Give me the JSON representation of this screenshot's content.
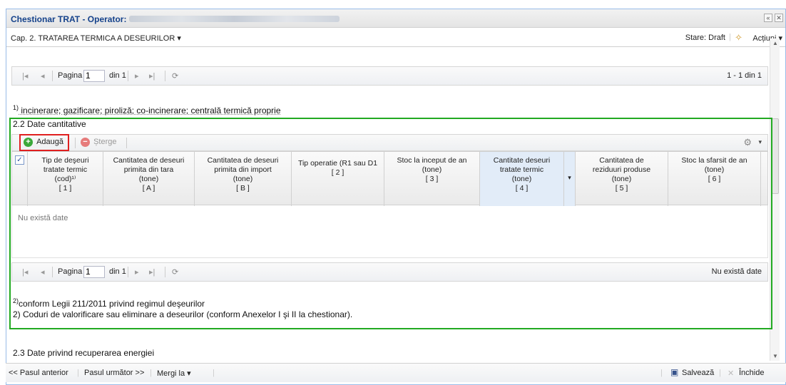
{
  "window": {
    "title": "Chestionar TRAT - Operator:",
    "collapse_icon": "double-chevron-up-icon",
    "close_icon": "close-icon"
  },
  "chapter": {
    "label": "Cap. 2. TRATAREA TERMICA A DESEURILOR ▾",
    "state": "Stare: Draft",
    "actions": "Acțiuni ▾"
  },
  "top_pager": {
    "page_label": "Pagina",
    "page_value": "1",
    "of_label": "din 1",
    "summary": "1 - 1 din 1"
  },
  "footnote1": {
    "sup": "1)",
    "text": " incinerare; gazificare; piroliză; co-incinerare; centrală termică proprie"
  },
  "section22": {
    "title": "2.2 Date cantitative",
    "add_label": "Adaugă",
    "delete_label": "Șterge",
    "columns": [
      {
        "l1": "Tip de deşeuri",
        "l2": "tratate termic",
        "l3": "(cod)¹⁾",
        "l4": "[ 1 ]"
      },
      {
        "l1": "Cantitatea de deseuri",
        "l2": "primita din tara",
        "l3": "(tone)",
        "l4": "[ A ]"
      },
      {
        "l1": "Cantitatea de deseuri",
        "l2": "primita din import",
        "l3": "(tone)",
        "l4": "[ B ]"
      },
      {
        "l1": "Tip operatie (R1 sau D1",
        "l2": "[ 2 ]",
        "l3": "",
        "l4": ""
      },
      {
        "l1": "Stoc la inceput de an",
        "l2": "(tone)",
        "l3": "[ 3 ]",
        "l4": ""
      },
      {
        "l1": "Cantitate deseuri",
        "l2": "tratate termic",
        "l3": "(tone)",
        "l4": "[ 4 ]"
      },
      {
        "l1": "Cantitatea de",
        "l2": "reziduuri produse",
        "l3": "(tone)",
        "l4": "[ 5 ]"
      },
      {
        "l1": "Stoc la sfarsit de an",
        "l2": "(tone)",
        "l3": "[ 6 ]",
        "l4": ""
      }
    ],
    "empty_text": "Nu există date",
    "pager": {
      "page_label": "Pagina",
      "page_value": "1",
      "of_label": "din 1",
      "summary": "Nu există date"
    },
    "note2_sup": "2)",
    "note2_text": "conform Legii 211/2011 privind regimul deşeurilor",
    "note3_text": "2) Coduri de valorificare sau eliminare a deseurilor (conform Anexelor I şi II la chestionar)."
  },
  "section23": {
    "title": "2.3 Date privind recuperarea energiei"
  },
  "bottom": {
    "prev": "<< Pasul anterior",
    "next": "Pasul următor >>",
    "goto": "Mergi la ▾",
    "save": "Salvează",
    "close": "Închide"
  }
}
